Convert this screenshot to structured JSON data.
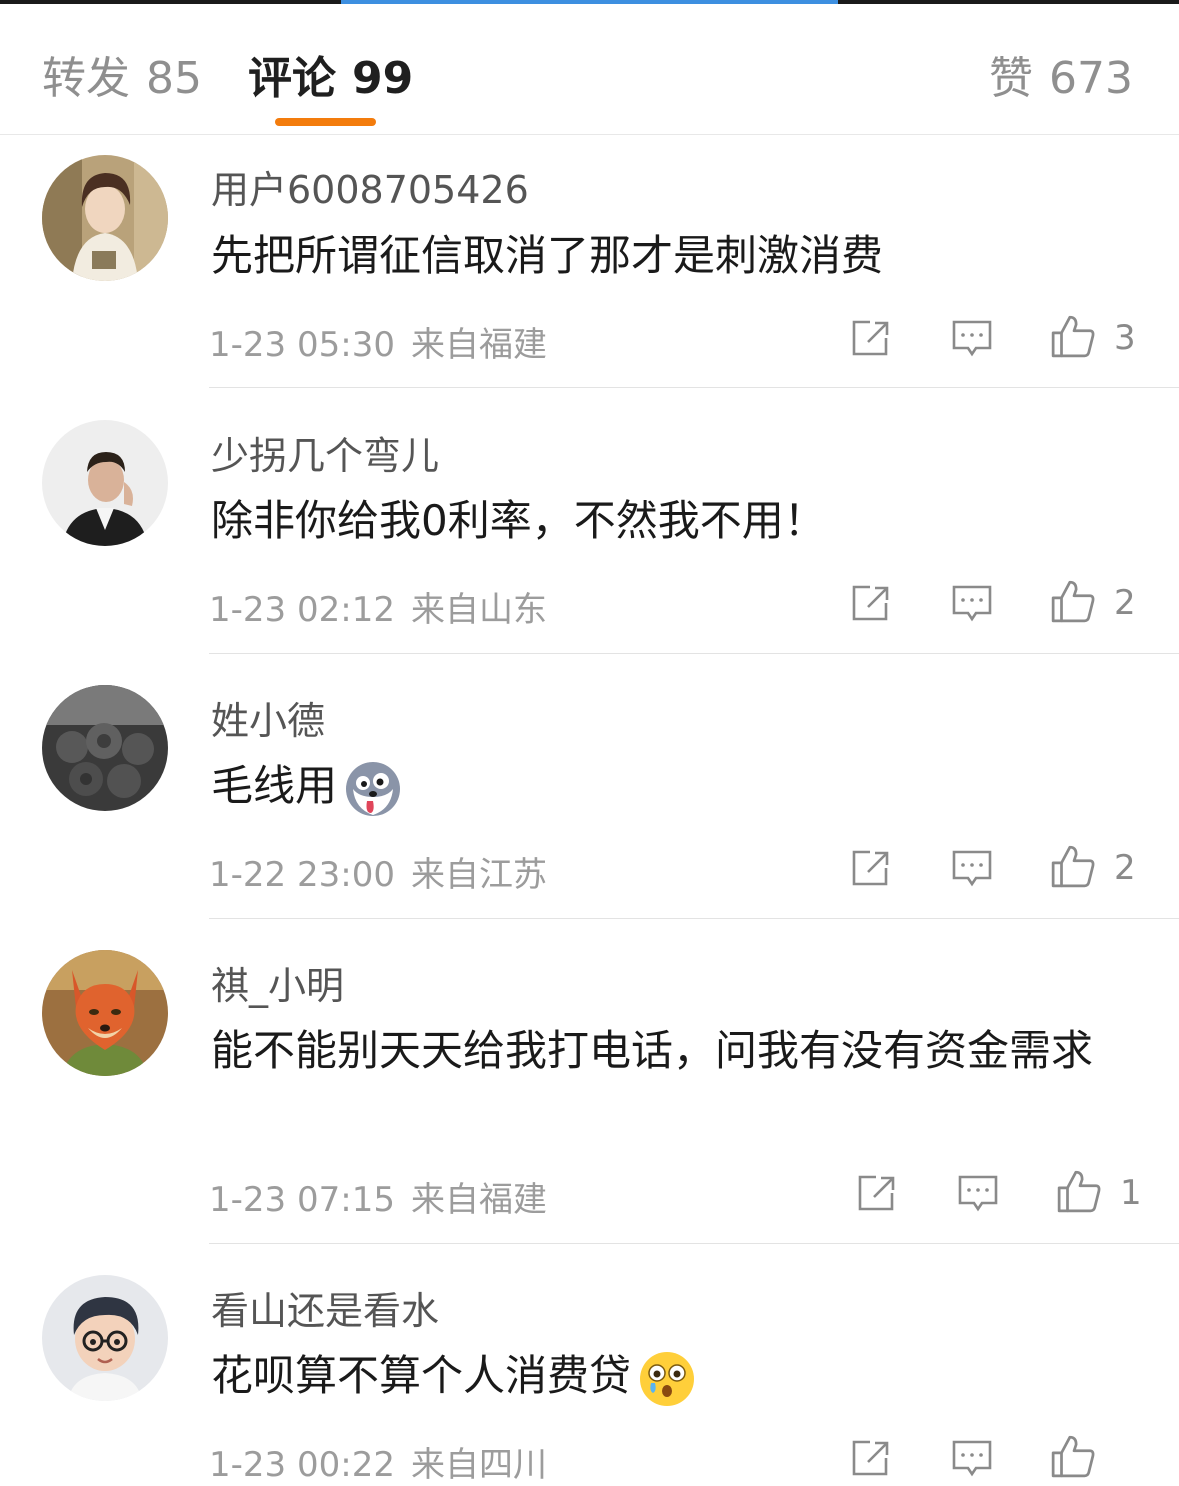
{
  "header": {
    "tabs": [
      {
        "label": "转发",
        "count": "85"
      },
      {
        "label": "评论",
        "count": "99"
      },
      {
        "label": "赞",
        "count": "673"
      }
    ],
    "active_tab": "评论",
    "accent_color": "#f37c0d"
  },
  "comments": [
    {
      "user": "用户6008705426",
      "text": "先把所谓征信取消了那才是刺激消费",
      "date": "1-23 05:30",
      "location": "来自福建",
      "likes": "3"
    },
    {
      "user": "少拐几个弯儿",
      "text": "除非你给我0利率，不然我不用！",
      "date": "1-23 02:12",
      "location": "来自山东",
      "likes": "2"
    },
    {
      "user": "姓小德",
      "text": "毛线用",
      "emoji": "husky-emoji",
      "date": "1-22 23:00",
      "location": "来自江苏",
      "likes": "2"
    },
    {
      "user": "祺_小明",
      "text": "能不能别天天给我打电话，问我有没有资金需求",
      "date": "1-23 07:15",
      "location": "来自福建",
      "likes": "1"
    },
    {
      "user": "看山还是看水",
      "text": "花呗算不算个人消费贷",
      "emoji": "shocked-crying-emoji",
      "date": "1-23 00:22",
      "location": "来自四川",
      "likes": ""
    }
  ],
  "icons": {
    "share": "share-icon",
    "reply": "comment-icon",
    "like": "thumbs-up-icon"
  }
}
